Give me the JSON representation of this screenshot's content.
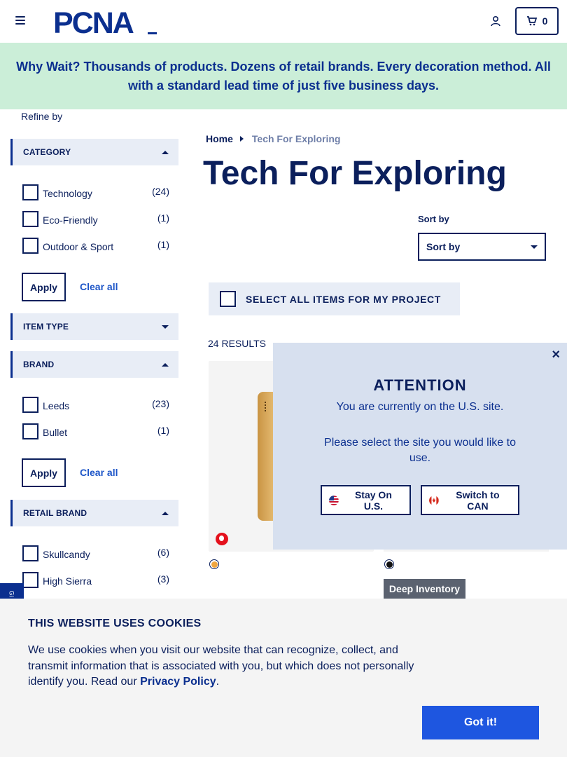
{
  "header": {
    "logo_text": "PCNA",
    "cart_count": "0",
    "icons": [
      "hamburger-icon",
      "account-icon",
      "cart-icon"
    ]
  },
  "banner": {
    "text": "Why Wait? Thousands of products. Dozens of retail brands. Every decoration method. All with a standard lead time of just five business days."
  },
  "sidebar": {
    "refine_label": "Refine by",
    "category": {
      "header": "CATEGORY",
      "items": [
        {
          "label": "Technology",
          "count": "(24)"
        },
        {
          "label": "Eco-Friendly",
          "count": "(1)"
        },
        {
          "label": "Outdoor & Sport",
          "count": "(1)"
        }
      ],
      "apply": "Apply",
      "clear": "Clear all"
    },
    "item_type": {
      "header": "ITEM TYPE"
    },
    "brand": {
      "header": "BRAND",
      "items": [
        {
          "label": "Leeds",
          "count": "(23)"
        },
        {
          "label": "Bullet",
          "count": "(1)"
        }
      ],
      "apply": "Apply",
      "clear": "Clear all"
    },
    "retail_brand": {
      "header": "RETAIL BRAND",
      "items": [
        {
          "label": "Skullcandy",
          "count": "(6)"
        },
        {
          "label": "High Sierra",
          "count": "(3)"
        }
      ]
    }
  },
  "main": {
    "breadcrumb": {
      "home": "Home",
      "current": "Tech For Exploring"
    },
    "title": "Tech For Exploring",
    "sort_label": "Sort by",
    "sort_value": "Sort by",
    "select_all": "SELECT ALL ITEMS FOR MY PROJECT",
    "results": "24 RESULTS",
    "products": [
      {
        "swatch_color": "#f0a640",
        "badge_color": "#e4111c"
      },
      {
        "swatch_color": "#111111",
        "badge": "Deep Inventory"
      }
    ]
  },
  "modal": {
    "close": "×",
    "title": "ATTENTION",
    "line1": "You are currently on the U.S. site.",
    "line2": "Please select the site you would like to use.",
    "stay_button": "Stay On U.S.",
    "switch_button": "Switch to CAN"
  },
  "gift_tab": "Gi",
  "cookie": {
    "title": "THIS WEBSITE USES COOKIES",
    "text": "We use cookies when you visit our website that can recognize, collect, and transmit information that is associated with you, but which does not personally identify you. Read our ",
    "privacy_link": "Privacy Policy",
    "period": ".",
    "button": "Got it!"
  },
  "colors": {
    "navy": "#0b1f5c",
    "banner_bg": "#cbeed8",
    "accent_blue": "#1e56e0",
    "modal_bg": "#d7e0ef"
  }
}
